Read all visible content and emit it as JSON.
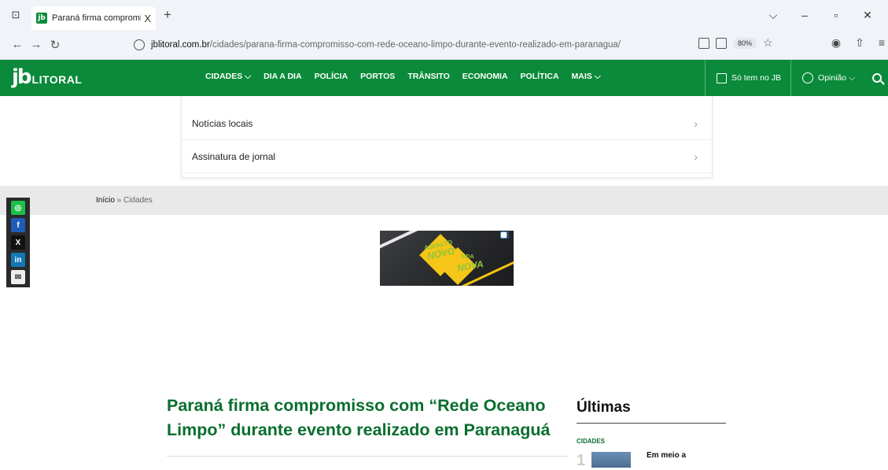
{
  "browser": {
    "tab_title": "Paraná firma compromisso com",
    "tab_close": "X",
    "new_tab": "+",
    "url_domain": "jblitoral.com.br",
    "url_path": "/cidades/parana-firma-compromisso-com-rede-oceano-limpo-durante-evento-realizado-em-paranagua/",
    "zoom": "80%"
  },
  "site": {
    "logo_jb": "jb",
    "logo_text": "LITORAL",
    "menu": [
      "CIDADES ⌵",
      "DIA A DIA",
      "POLÍCIA",
      "PORTOS",
      "TRÂNSITO",
      "ECONOMIA",
      "POLÍTICA",
      "MAIS ⌵"
    ],
    "only_jb": "Só tem no JB",
    "opinion": "Opinião ⌵"
  },
  "dropdown": {
    "items": [
      "Notícias locais",
      "Assinatura de jornal"
    ]
  },
  "breadcrumb": {
    "home": "Início",
    "sep": " » ",
    "current": "Cidades"
  },
  "share": {
    "facebook": "f",
    "x": "X",
    "linkedin": "in"
  },
  "ad": {
    "line1": "ASFALTO",
    "line2": "NOVO",
    "line3": "VIDA",
    "line4": "NOVA"
  },
  "article": {
    "headline": "Paraná firma compromisso com “Rede Oceano Limpo” durante evento realizado em Paranaguá"
  },
  "latest": {
    "title": "Últimas",
    "category": "CIDADES",
    "number": "1",
    "item_text": "Em meio a"
  },
  "colors": {
    "brand_green": "#0a8a3a",
    "headline_green": "#0a6e2f"
  }
}
